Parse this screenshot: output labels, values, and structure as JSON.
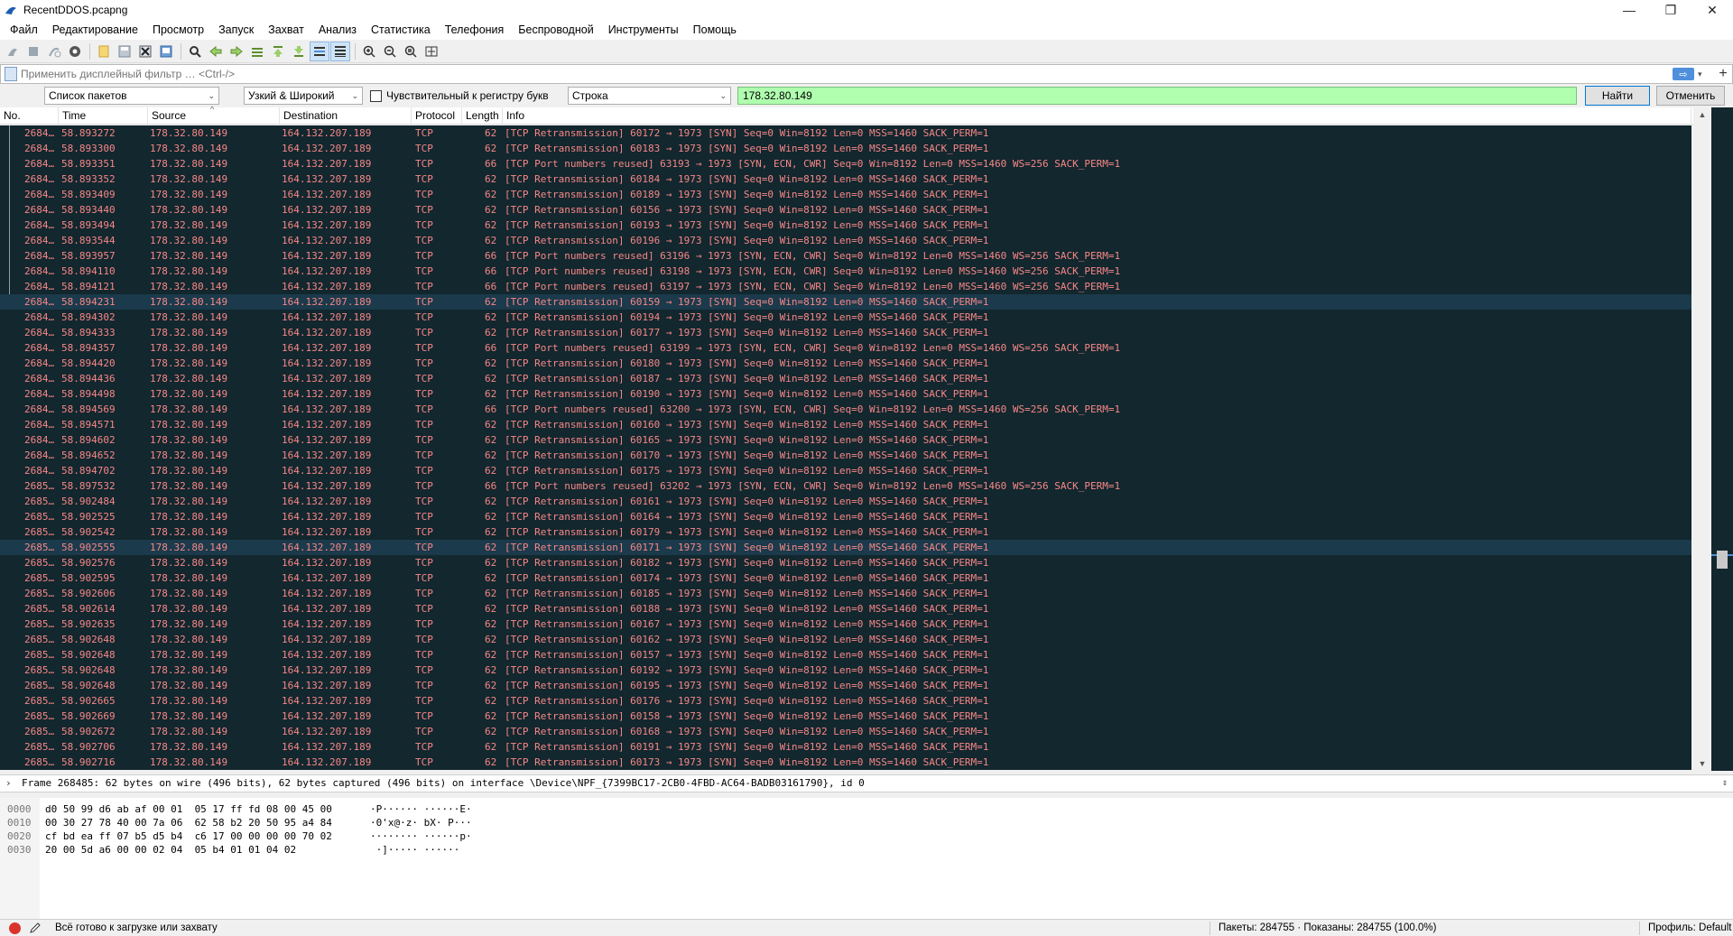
{
  "window": {
    "title": "RecentDDOS.pcapng"
  },
  "window_controls": {
    "minimize": "—",
    "maximize": "❐",
    "close": "✕"
  },
  "menu": [
    "Файл",
    "Редактирование",
    "Просмотр",
    "Запуск",
    "Захват",
    "Анализ",
    "Статистика",
    "Телефония",
    "Беспроводной",
    "Инструменты",
    "Помощь"
  ],
  "toolbar": {
    "icons": [
      "start-capture-icon",
      "stop-capture-icon",
      "restart-capture-icon",
      "capture-options-icon",
      "open-file-icon",
      "save-file-icon",
      "close-file-icon",
      "reload-file-icon",
      "find-packet-icon",
      "go-back-icon",
      "go-forward-icon",
      "go-to-packet-icon",
      "go-first-icon",
      "go-last-icon",
      "autoscroll-icon",
      "colorize-icon",
      "zoom-in-icon",
      "zoom-out-icon",
      "zoom-normal-icon",
      "resize-columns-icon"
    ]
  },
  "display_filter": {
    "placeholder": "Применить дисплейный фильтр … <Ctrl-/>",
    "value": ""
  },
  "find_bar": {
    "search_in": "Список пакетов",
    "char_width": "Узкий & Широкий",
    "case_sensitive_label": "Чувствительный к регистру букв",
    "case_sensitive": false,
    "search_type": "Строка",
    "search_value": "178.32.80.149",
    "find_button": "Найти",
    "cancel_button": "Отменить"
  },
  "columns": [
    "No.",
    "Time",
    "Source",
    "Destination",
    "Protocol",
    "Length",
    "Info"
  ],
  "packets": [
    {
      "no": "2684…",
      "time": "58.893272",
      "src": "178.32.80.149",
      "dst": "164.132.207.189",
      "proto": "TCP",
      "len": "62",
      "info": "[TCP Retransmission] 60172 → 1973 [SYN] Seq=0 Win=8192 Len=0 MSS=1460 SACK_PERM=1"
    },
    {
      "no": "2684…",
      "time": "58.893300",
      "src": "178.32.80.149",
      "dst": "164.132.207.189",
      "proto": "TCP",
      "len": "62",
      "info": "[TCP Retransmission] 60183 → 1973 [SYN] Seq=0 Win=8192 Len=0 MSS=1460 SACK_PERM=1"
    },
    {
      "no": "2684…",
      "time": "58.893351",
      "src": "178.32.80.149",
      "dst": "164.132.207.189",
      "proto": "TCP",
      "len": "66",
      "info": "[TCP Port numbers reused] 63193 → 1973 [SYN, ECN, CWR] Seq=0 Win=8192 Len=0 MSS=1460 WS=256 SACK_PERM=1"
    },
    {
      "no": "2684…",
      "time": "58.893352",
      "src": "178.32.80.149",
      "dst": "164.132.207.189",
      "proto": "TCP",
      "len": "62",
      "info": "[TCP Retransmission] 60184 → 1973 [SYN] Seq=0 Win=8192 Len=0 MSS=1460 SACK_PERM=1"
    },
    {
      "no": "2684…",
      "time": "58.893409",
      "src": "178.32.80.149",
      "dst": "164.132.207.189",
      "proto": "TCP",
      "len": "62",
      "info": "[TCP Retransmission] 60189 → 1973 [SYN] Seq=0 Win=8192 Len=0 MSS=1460 SACK_PERM=1"
    },
    {
      "no": "2684…",
      "time": "58.893440",
      "src": "178.32.80.149",
      "dst": "164.132.207.189",
      "proto": "TCP",
      "len": "62",
      "info": "[TCP Retransmission] 60156 → 1973 [SYN] Seq=0 Win=8192 Len=0 MSS=1460 SACK_PERM=1"
    },
    {
      "no": "2684…",
      "time": "58.893494",
      "src": "178.32.80.149",
      "dst": "164.132.207.189",
      "proto": "TCP",
      "len": "62",
      "info": "[TCP Retransmission] 60193 → 1973 [SYN] Seq=0 Win=8192 Len=0 MSS=1460 SACK_PERM=1"
    },
    {
      "no": "2684…",
      "time": "58.893544",
      "src": "178.32.80.149",
      "dst": "164.132.207.189",
      "proto": "TCP",
      "len": "62",
      "info": "[TCP Retransmission] 60196 → 1973 [SYN] Seq=0 Win=8192 Len=0 MSS=1460 SACK_PERM=1"
    },
    {
      "no": "2684…",
      "time": "58.893957",
      "src": "178.32.80.149",
      "dst": "164.132.207.189",
      "proto": "TCP",
      "len": "66",
      "info": "[TCP Port numbers reused] 63196 → 1973 [SYN, ECN, CWR] Seq=0 Win=8192 Len=0 MSS=1460 WS=256 SACK_PERM=1"
    },
    {
      "no": "2684…",
      "time": "58.894110",
      "src": "178.32.80.149",
      "dst": "164.132.207.189",
      "proto": "TCP",
      "len": "66",
      "info": "[TCP Port numbers reused] 63198 → 1973 [SYN, ECN, CWR] Seq=0 Win=8192 Len=0 MSS=1460 WS=256 SACK_PERM=1"
    },
    {
      "no": "2684…",
      "time": "58.894121",
      "src": "178.32.80.149",
      "dst": "164.132.207.189",
      "proto": "TCP",
      "len": "66",
      "info": "[TCP Port numbers reused] 63197 → 1973 [SYN, ECN, CWR] Seq=0 Win=8192 Len=0 MSS=1460 WS=256 SACK_PERM=1"
    },
    {
      "no": "2684…",
      "time": "58.894231",
      "src": "178.32.80.149",
      "dst": "164.132.207.189",
      "proto": "TCP",
      "len": "62",
      "info": "[TCP Retransmission] 60159 → 1973 [SYN] Seq=0 Win=8192 Len=0 MSS=1460 SACK_PERM=1"
    },
    {
      "no": "2684…",
      "time": "58.894302",
      "src": "178.32.80.149",
      "dst": "164.132.207.189",
      "proto": "TCP",
      "len": "62",
      "info": "[TCP Retransmission] 60194 → 1973 [SYN] Seq=0 Win=8192 Len=0 MSS=1460 SACK_PERM=1"
    },
    {
      "no": "2684…",
      "time": "58.894333",
      "src": "178.32.80.149",
      "dst": "164.132.207.189",
      "proto": "TCP",
      "len": "62",
      "info": "[TCP Retransmission] 60177 → 1973 [SYN] Seq=0 Win=8192 Len=0 MSS=1460 SACK_PERM=1"
    },
    {
      "no": "2684…",
      "time": "58.894357",
      "src": "178.32.80.149",
      "dst": "164.132.207.189",
      "proto": "TCP",
      "len": "66",
      "info": "[TCP Port numbers reused] 63199 → 1973 [SYN, ECN, CWR] Seq=0 Win=8192 Len=0 MSS=1460 WS=256 SACK_PERM=1"
    },
    {
      "no": "2684…",
      "time": "58.894420",
      "src": "178.32.80.149",
      "dst": "164.132.207.189",
      "proto": "TCP",
      "len": "62",
      "info": "[TCP Retransmission] 60180 → 1973 [SYN] Seq=0 Win=8192 Len=0 MSS=1460 SACK_PERM=1"
    },
    {
      "no": "2684…",
      "time": "58.894436",
      "src": "178.32.80.149",
      "dst": "164.132.207.189",
      "proto": "TCP",
      "len": "62",
      "info": "[TCP Retransmission] 60187 → 1973 [SYN] Seq=0 Win=8192 Len=0 MSS=1460 SACK_PERM=1"
    },
    {
      "no": "2684…",
      "time": "58.894498",
      "src": "178.32.80.149",
      "dst": "164.132.207.189",
      "proto": "TCP",
      "len": "62",
      "info": "[TCP Retransmission] 60190 → 1973 [SYN] Seq=0 Win=8192 Len=0 MSS=1460 SACK_PERM=1"
    },
    {
      "no": "2684…",
      "time": "58.894569",
      "src": "178.32.80.149",
      "dst": "164.132.207.189",
      "proto": "TCP",
      "len": "66",
      "info": "[TCP Port numbers reused] 63200 → 1973 [SYN, ECN, CWR] Seq=0 Win=8192 Len=0 MSS=1460 WS=256 SACK_PERM=1"
    },
    {
      "no": "2684…",
      "time": "58.894571",
      "src": "178.32.80.149",
      "dst": "164.132.207.189",
      "proto": "TCP",
      "len": "62",
      "info": "[TCP Retransmission] 60160 → 1973 [SYN] Seq=0 Win=8192 Len=0 MSS=1460 SACK_PERM=1"
    },
    {
      "no": "2684…",
      "time": "58.894602",
      "src": "178.32.80.149",
      "dst": "164.132.207.189",
      "proto": "TCP",
      "len": "62",
      "info": "[TCP Retransmission] 60165 → 1973 [SYN] Seq=0 Win=8192 Len=0 MSS=1460 SACK_PERM=1"
    },
    {
      "no": "2684…",
      "time": "58.894652",
      "src": "178.32.80.149",
      "dst": "164.132.207.189",
      "proto": "TCP",
      "len": "62",
      "info": "[TCP Retransmission] 60170 → 1973 [SYN] Seq=0 Win=8192 Len=0 MSS=1460 SACK_PERM=1"
    },
    {
      "no": "2684…",
      "time": "58.894702",
      "src": "178.32.80.149",
      "dst": "164.132.207.189",
      "proto": "TCP",
      "len": "62",
      "info": "[TCP Retransmission] 60175 → 1973 [SYN] Seq=0 Win=8192 Len=0 MSS=1460 SACK_PERM=1"
    },
    {
      "no": "2685…",
      "time": "58.897532",
      "src": "178.32.80.149",
      "dst": "164.132.207.189",
      "proto": "TCP",
      "len": "66",
      "info": "[TCP Port numbers reused] 63202 → 1973 [SYN, ECN, CWR] Seq=0 Win=8192 Len=0 MSS=1460 WS=256 SACK_PERM=1"
    },
    {
      "no": "2685…",
      "time": "58.902484",
      "src": "178.32.80.149",
      "dst": "164.132.207.189",
      "proto": "TCP",
      "len": "62",
      "info": "[TCP Retransmission] 60161 → 1973 [SYN] Seq=0 Win=8192 Len=0 MSS=1460 SACK_PERM=1"
    },
    {
      "no": "2685…",
      "time": "58.902525",
      "src": "178.32.80.149",
      "dst": "164.132.207.189",
      "proto": "TCP",
      "len": "62",
      "info": "[TCP Retransmission] 60164 → 1973 [SYN] Seq=0 Win=8192 Len=0 MSS=1460 SACK_PERM=1"
    },
    {
      "no": "2685…",
      "time": "58.902542",
      "src": "178.32.80.149",
      "dst": "164.132.207.189",
      "proto": "TCP",
      "len": "62",
      "info": "[TCP Retransmission] 60179 → 1973 [SYN] Seq=0 Win=8192 Len=0 MSS=1460 SACK_PERM=1"
    },
    {
      "no": "2685…",
      "time": "58.902555",
      "src": "178.32.80.149",
      "dst": "164.132.207.189",
      "proto": "TCP",
      "len": "62",
      "info": "[TCP Retransmission] 60171 → 1973 [SYN] Seq=0 Win=8192 Len=0 MSS=1460 SACK_PERM=1"
    },
    {
      "no": "2685…",
      "time": "58.902576",
      "src": "178.32.80.149",
      "dst": "164.132.207.189",
      "proto": "TCP",
      "len": "62",
      "info": "[TCP Retransmission] 60182 → 1973 [SYN] Seq=0 Win=8192 Len=0 MSS=1460 SACK_PERM=1"
    },
    {
      "no": "2685…",
      "time": "58.902595",
      "src": "178.32.80.149",
      "dst": "164.132.207.189",
      "proto": "TCP",
      "len": "62",
      "info": "[TCP Retransmission] 60174 → 1973 [SYN] Seq=0 Win=8192 Len=0 MSS=1460 SACK_PERM=1"
    },
    {
      "no": "2685…",
      "time": "58.902606",
      "src": "178.32.80.149",
      "dst": "164.132.207.189",
      "proto": "TCP",
      "len": "62",
      "info": "[TCP Retransmission] 60185 → 1973 [SYN] Seq=0 Win=8192 Len=0 MSS=1460 SACK_PERM=1"
    },
    {
      "no": "2685…",
      "time": "58.902614",
      "src": "178.32.80.149",
      "dst": "164.132.207.189",
      "proto": "TCP",
      "len": "62",
      "info": "[TCP Retransmission] 60188 → 1973 [SYN] Seq=0 Win=8192 Len=0 MSS=1460 SACK_PERM=1"
    },
    {
      "no": "2685…",
      "time": "58.902635",
      "src": "178.32.80.149",
      "dst": "164.132.207.189",
      "proto": "TCP",
      "len": "62",
      "info": "[TCP Retransmission] 60167 → 1973 [SYN] Seq=0 Win=8192 Len=0 MSS=1460 SACK_PERM=1"
    },
    {
      "no": "2685…",
      "time": "58.902648",
      "src": "178.32.80.149",
      "dst": "164.132.207.189",
      "proto": "TCP",
      "len": "62",
      "info": "[TCP Retransmission] 60162 → 1973 [SYN] Seq=0 Win=8192 Len=0 MSS=1460 SACK_PERM=1"
    },
    {
      "no": "2685…",
      "time": "58.902648",
      "src": "178.32.80.149",
      "dst": "164.132.207.189",
      "proto": "TCP",
      "len": "62",
      "info": "[TCP Retransmission] 60157 → 1973 [SYN] Seq=0 Win=8192 Len=0 MSS=1460 SACK_PERM=1"
    },
    {
      "no": "2685…",
      "time": "58.902648",
      "src": "178.32.80.149",
      "dst": "164.132.207.189",
      "proto": "TCP",
      "len": "62",
      "info": "[TCP Retransmission] 60192 → 1973 [SYN] Seq=0 Win=8192 Len=0 MSS=1460 SACK_PERM=1"
    },
    {
      "no": "2685…",
      "time": "58.902648",
      "src": "178.32.80.149",
      "dst": "164.132.207.189",
      "proto": "TCP",
      "len": "62",
      "info": "[TCP Retransmission] 60195 → 1973 [SYN] Seq=0 Win=8192 Len=0 MSS=1460 SACK_PERM=1"
    },
    {
      "no": "2685…",
      "time": "58.902665",
      "src": "178.32.80.149",
      "dst": "164.132.207.189",
      "proto": "TCP",
      "len": "62",
      "info": "[TCP Retransmission] 60176 → 1973 [SYN] Seq=0 Win=8192 Len=0 MSS=1460 SACK_PERM=1"
    },
    {
      "no": "2685…",
      "time": "58.902669",
      "src": "178.32.80.149",
      "dst": "164.132.207.189",
      "proto": "TCP",
      "len": "62",
      "info": "[TCP Retransmission] 60158 → 1973 [SYN] Seq=0 Win=8192 Len=0 MSS=1460 SACK_PERM=1"
    },
    {
      "no": "2685…",
      "time": "58.902672",
      "src": "178.32.80.149",
      "dst": "164.132.207.189",
      "proto": "TCP",
      "len": "62",
      "info": "[TCP Retransmission] 60168 → 1973 [SYN] Seq=0 Win=8192 Len=0 MSS=1460 SACK_PERM=1"
    },
    {
      "no": "2685…",
      "time": "58.902706",
      "src": "178.32.80.149",
      "dst": "164.132.207.189",
      "proto": "TCP",
      "len": "62",
      "info": "[TCP Retransmission] 60191 → 1973 [SYN] Seq=0 Win=8192 Len=0 MSS=1460 SACK_PERM=1"
    },
    {
      "no": "2685…",
      "time": "58.902716",
      "src": "178.32.80.149",
      "dst": "164.132.207.189",
      "proto": "TCP",
      "len": "62",
      "info": "[TCP Retransmission] 60173 → 1973 [SYN] Seq=0 Win=8192 Len=0 MSS=1460 SACK_PERM=1"
    }
  ],
  "selected_row_index": 11,
  "related_row_index": 27,
  "details": {
    "expander": "›",
    "text": "Frame 268485: 62 bytes on wire (496 bits), 62 bytes captured (496 bits) on interface \\Device\\NPF_{7399BC17-2CB0-4FBD-AC64-BADB03161790}, id 0"
  },
  "bytes": [
    {
      "offset": "0000",
      "hex": "d0 50 99 d6 ab af 00 01  05 17 ff fd 08 00 45 00",
      "ascii": "·P······ ······E·"
    },
    {
      "offset": "0010",
      "hex": "00 30 27 78 40 00 7a 06  62 58 b2 20 50 95 a4 84",
      "ascii": "·0'x@·z· bX· P···"
    },
    {
      "offset": "0020",
      "hex": "cf bd ea ff 07 b5 d5 b4  c6 17 00 00 00 00 70 02",
      "ascii": "········ ······p·"
    },
    {
      "offset": "0030",
      "hex": "20 00 5d a6 00 00 02 04  05 b4 01 01 04 02",
      "ascii": " ·]····· ······"
    }
  ],
  "status": {
    "ready": "Всё готово к загрузке или захвату",
    "packets": "Пакеты: 284755 · Показаны: 284755 (100.0%)",
    "profile": "Профиль: Default"
  },
  "colors": {
    "row_bg": "#12272e",
    "row_fg": "#f78787",
    "selected_bg": "#1b3a4b",
    "find_match_bg": "#afffaf",
    "expert_error": "#d9342b"
  }
}
